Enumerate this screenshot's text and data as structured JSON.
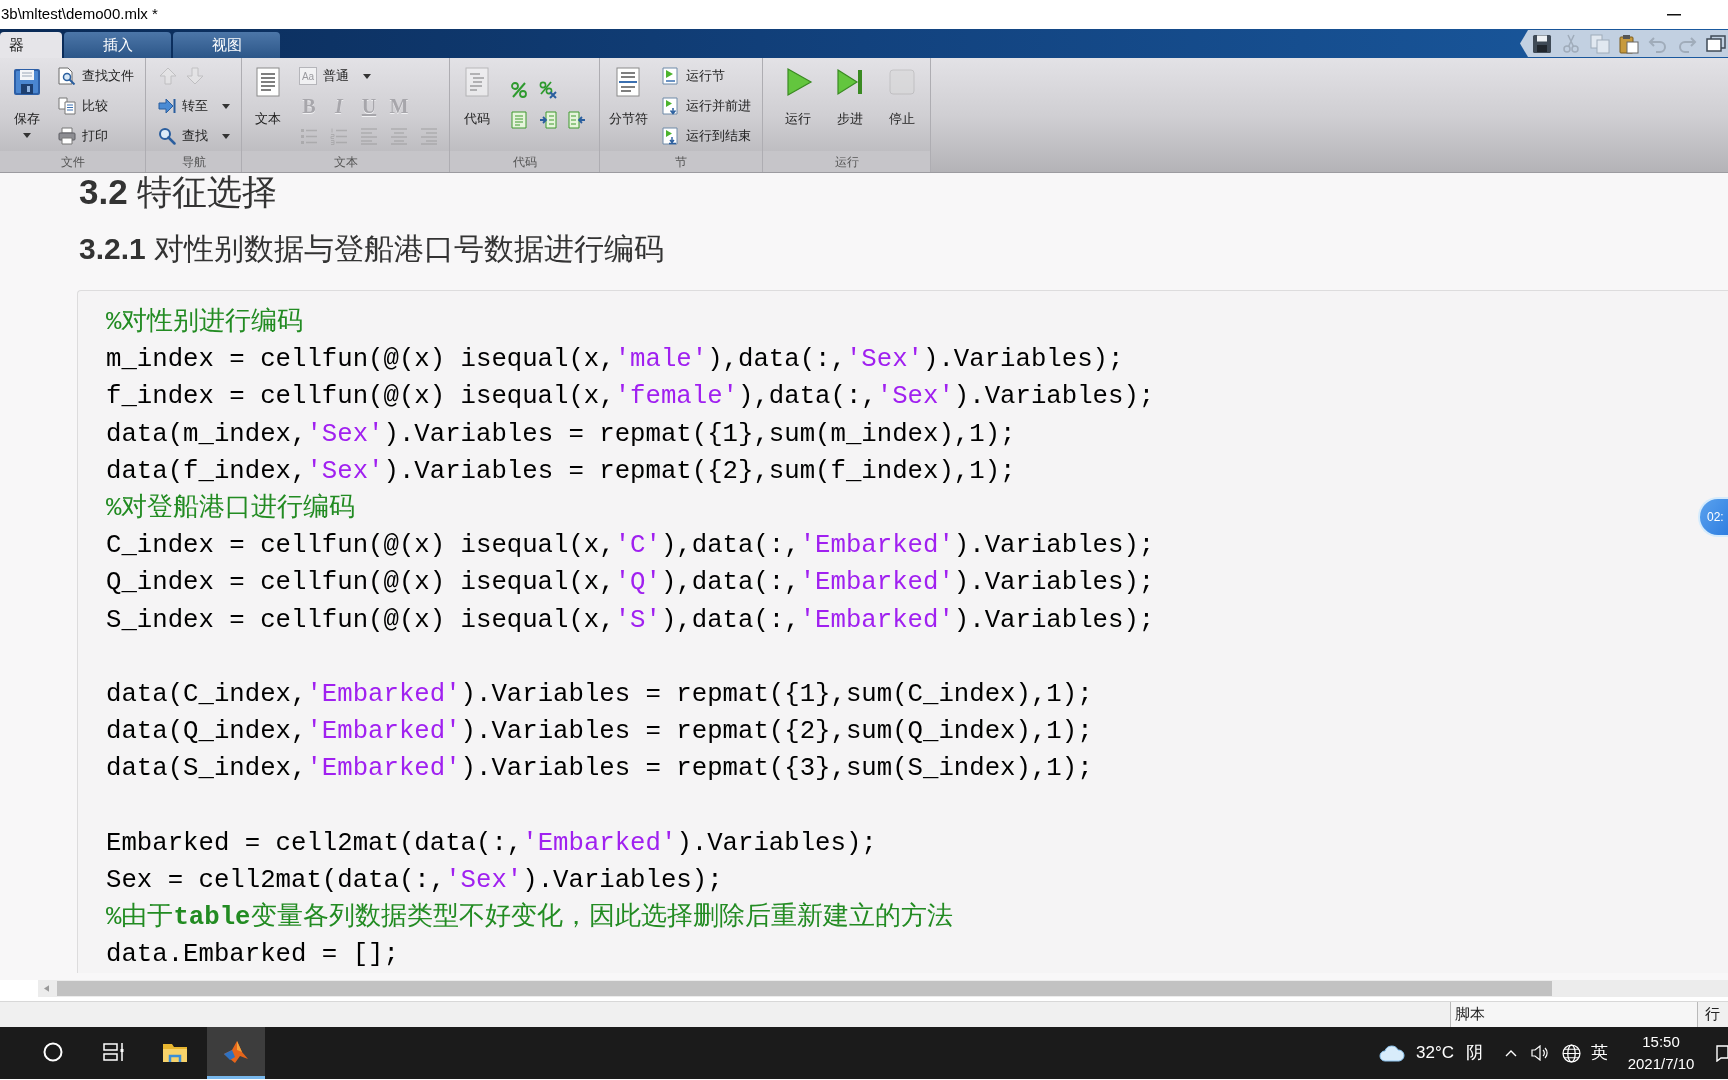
{
  "window": {
    "title": "3b\\mltest\\demo00.mlx *"
  },
  "ribbon_tabs": [
    {
      "label": "器",
      "selected": true
    },
    {
      "label": "插入",
      "selected": false
    },
    {
      "label": "视图",
      "selected": false
    }
  ],
  "quick_access_toolbar": [
    {
      "disabled": false
    },
    {
      "disabled": true
    },
    {
      "disabled": true
    },
    {
      "disabled": false
    },
    {
      "disabled": true
    },
    {
      "disabled": true
    },
    {
      "disabled": false
    }
  ],
  "ribbon_groups": [
    {
      "label": "文件",
      "large_buttons": [
        {
          "label": "保存",
          "dropdown": true,
          "disabled": false
        }
      ],
      "rows": [
        [
          {
            "kind": "labeled",
            "label": "查找文件",
            "dropdown": false,
            "disabled": false
          }
        ],
        [
          {
            "kind": "labeled",
            "label": "比较",
            "dropdown": false,
            "disabled": false
          }
        ],
        [
          {
            "kind": "labeled",
            "label": "打印",
            "dropdown": false,
            "disabled": false
          }
        ]
      ]
    },
    {
      "label": "导航",
      "rows": [
        [
          {
            "kind": "icon",
            "disabled": true
          },
          {
            "kind": "icon",
            "disabled": true
          }
        ],
        [
          {
            "kind": "labeled",
            "label": "转至",
            "dropdown": true,
            "disabled": false
          }
        ],
        [
          {
            "kind": "labeled",
            "label": "查找",
            "dropdown": true,
            "disabled": false
          }
        ]
      ]
    },
    {
      "label": "文本",
      "large_buttons": [
        {
          "label": "文本",
          "dropdown": false,
          "disabled": false
        }
      ],
      "rows": [
        [
          {
            "kind": "style",
            "sample": "Aa",
            "label": "普通",
            "dropdown": true,
            "disabled": false
          }
        ],
        [
          {
            "kind": "glyph",
            "glyph": "B",
            "disabled": true
          },
          {
            "kind": "glyph",
            "glyph": "I",
            "disabled": true
          },
          {
            "kind": "glyph",
            "glyph": "U",
            "disabled": true
          },
          {
            "kind": "glyph",
            "glyph": "M",
            "disabled": true
          }
        ],
        [
          {
            "kind": "icon",
            "disabled": true
          },
          {
            "kind": "icon",
            "disabled": true
          },
          {
            "kind": "icon",
            "disabled": true
          },
          {
            "kind": "icon",
            "disabled": true
          },
          {
            "kind": "icon",
            "disabled": true
          }
        ]
      ]
    },
    {
      "label": "代码",
      "large_buttons": [
        {
          "label": "代码",
          "dropdown": false,
          "disabled": true
        }
      ],
      "rows": [
        [
          {
            "kind": "icon",
            "disabled": false
          },
          {
            "kind": "icon",
            "disabled": false
          }
        ],
        [
          {
            "kind": "icon",
            "disabled": false
          },
          {
            "kind": "icon",
            "disabled": false
          },
          {
            "kind": "icon",
            "disabled": false
          }
        ]
      ]
    },
    {
      "label": "节",
      "large_buttons": [
        {
          "label": "分节符",
          "dropdown": false,
          "disabled": false
        }
      ],
      "rows": [
        [
          {
            "kind": "labeled",
            "label": "运行节",
            "dropdown": false,
            "disabled": false
          }
        ],
        [
          {
            "kind": "labeled",
            "label": "运行并前进",
            "dropdown": false,
            "disabled": false
          }
        ],
        [
          {
            "kind": "labeled",
            "label": "运行到结束",
            "dropdown": false,
            "disabled": false
          }
        ]
      ]
    },
    {
      "label": "运行",
      "large_buttons": [
        {
          "label": "运行",
          "dropdown": false,
          "disabled": false
        },
        {
          "label": "步进",
          "dropdown": false,
          "disabled": false
        },
        {
          "label": "停止",
          "dropdown": false,
          "disabled": true
        }
      ]
    }
  ],
  "document": {
    "headings": [
      {
        "kind": "section",
        "text": "**3.2** 特征选择"
      },
      {
        "kind": "subsection",
        "text": "**3.2.1** 对性别数据与登船港口号数据进行编码"
      }
    ],
    "code_paragraphs": [
      [
        [
          {
            "kind": "comment",
            "text": "%对性别进行编码"
          }
        ],
        [
          {
            "kind": "code",
            "text": "m_index = cellfun(@(x) isequal(x,"
          },
          {
            "kind": "string",
            "text": "'male'"
          },
          {
            "kind": "code",
            "text": "),data(:,"
          },
          {
            "kind": "string",
            "text": "'Sex'"
          },
          {
            "kind": "code",
            "text": ").Variables);"
          }
        ],
        [
          {
            "kind": "code",
            "text": "f_index = cellfun(@(x) isequal(x,"
          },
          {
            "kind": "string",
            "text": "'female'"
          },
          {
            "kind": "code",
            "text": "),data(:,"
          },
          {
            "kind": "string",
            "text": "'Sex'"
          },
          {
            "kind": "code",
            "text": ").Variables);"
          }
        ],
        [
          {
            "kind": "code",
            "text": "data(m_index,"
          },
          {
            "kind": "string",
            "text": "'Sex'"
          },
          {
            "kind": "code",
            "text": ").Variables = repmat({1},sum(m_index),1);"
          }
        ],
        [
          {
            "kind": "code",
            "text": "data(f_index,"
          },
          {
            "kind": "string",
            "text": "'Sex'"
          },
          {
            "kind": "code",
            "text": ").Variables = repmat({2},sum(f_index),1);"
          }
        ],
        [
          {
            "kind": "comment",
            "text": "%对登船港口进行编码"
          }
        ],
        [
          {
            "kind": "code",
            "text": "C_index = cellfun(@(x) isequal(x,"
          },
          {
            "kind": "string",
            "text": "'C'"
          },
          {
            "kind": "code",
            "text": "),data(:,"
          },
          {
            "kind": "string",
            "text": "'Embarked'"
          },
          {
            "kind": "code",
            "text": ").Variables);"
          }
        ],
        [
          {
            "kind": "code",
            "text": "Q_index = cellfun(@(x) isequal(x,"
          },
          {
            "kind": "string",
            "text": "'Q'"
          },
          {
            "kind": "code",
            "text": "),data(:,"
          },
          {
            "kind": "string",
            "text": "'Embarked'"
          },
          {
            "kind": "code",
            "text": ").Variables);"
          }
        ],
        [
          {
            "kind": "code",
            "text": "S_index = cellfun(@(x) isequal(x,"
          },
          {
            "kind": "string",
            "text": "'S'"
          },
          {
            "kind": "code",
            "text": "),data(:,"
          },
          {
            "kind": "string",
            "text": "'Embarked'"
          },
          {
            "kind": "code",
            "text": ").Variables);"
          }
        ]
      ],
      [
        [
          {
            "kind": "code",
            "text": "data(C_index,"
          },
          {
            "kind": "string",
            "text": "'Embarked'"
          },
          {
            "kind": "code",
            "text": ").Variables = repmat({1},sum(C_index),1);"
          }
        ],
        [
          {
            "kind": "code",
            "text": "data(Q_index,"
          },
          {
            "kind": "string",
            "text": "'Embarked'"
          },
          {
            "kind": "code",
            "text": ").Variables = repmat({2},sum(Q_index),1);"
          }
        ],
        [
          {
            "kind": "code",
            "text": "data(S_index,"
          },
          {
            "kind": "string",
            "text": "'Embarked'"
          },
          {
            "kind": "code",
            "text": ").Variables = repmat({3},sum(S_index),1);"
          }
        ]
      ],
      [
        [
          {
            "kind": "code",
            "text": "Embarked = cell2mat(data(:,"
          },
          {
            "kind": "string",
            "text": "'Embarked'"
          },
          {
            "kind": "code",
            "text": ").Variables);"
          }
        ],
        [
          {
            "kind": "code",
            "text": "Sex = cell2mat(data(:,"
          },
          {
            "kind": "string",
            "text": "'Sex'"
          },
          {
            "kind": "code",
            "text": ").Variables);"
          }
        ],
        [
          {
            "kind": "comment",
            "text": "%由于**table**变量各列数据类型不好变化，因此选择删除后重新建立的方法"
          }
        ],
        [
          {
            "kind": "code",
            "text": "data.Embarked = [];"
          }
        ]
      ]
    ]
  },
  "status_bar": {
    "fields": [
      "脚本",
      "行"
    ]
  },
  "floating_timer": {
    "text": "02:"
  },
  "taskbar": {
    "apps": [
      {
        "active": false
      },
      {
        "active": false
      },
      {
        "active": false
      },
      {
        "active": true
      }
    ],
    "weather": {
      "temperature": "32°C",
      "condition": "阴"
    },
    "input_method": "英",
    "clock": {
      "time": "15:50",
      "date": "2021/7/10"
    }
  }
}
